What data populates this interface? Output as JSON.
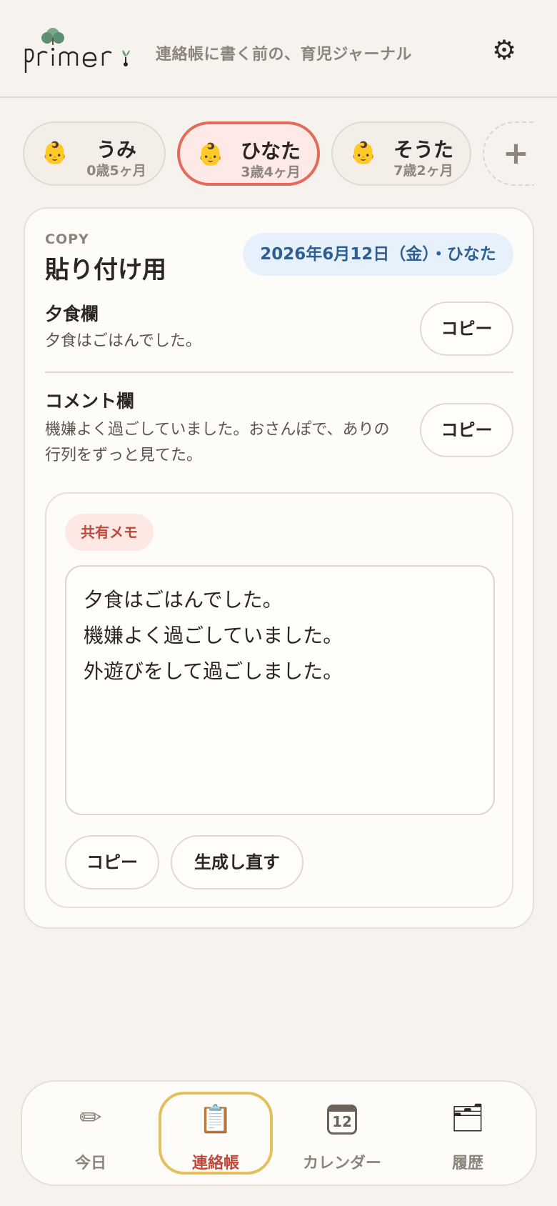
{
  "header": {
    "logo_text": "primer",
    "tagline": "連絡帳に書く前の、育児ジャーナル",
    "settings_icon": "gear-icon"
  },
  "children": [
    {
      "avatar": "👶",
      "name": "うみ",
      "age": "0歳5ヶ月",
      "selected": false
    },
    {
      "avatar": "👶",
      "name": "ひなた",
      "age": "3歳4ヶ月",
      "selected": true
    },
    {
      "avatar": "👶",
      "name": "そうた",
      "age": "7歳2ヶ月",
      "selected": false
    }
  ],
  "add_child": {
    "label": "+",
    "icon": "plus-icon"
  },
  "copy_card": {
    "eyebrow": "COPY",
    "title": "貼り付け用",
    "date_badge": "2026年6月12日（金）・ひなた",
    "fields": [
      {
        "title": "夕食欄",
        "body": "夕食はごはんでした。",
        "button": "コピー"
      },
      {
        "title": "コメント欄",
        "body": "機嫌よく過ごしていました。おさんぽで、ありの行列をずっと見てた。",
        "button": "コピー"
      }
    ],
    "memo": {
      "badge": "共有メモ",
      "lines": [
        "夕食はごはんでした。",
        "機嫌よく過ごしていました。",
        "外遊びをして過ごしました。"
      ],
      "copy_button": "コピー",
      "regenerate_button": "生成し直す"
    }
  },
  "bottom_nav": [
    {
      "icon": "pencil-icon",
      "glyph": "✏",
      "label": "今日",
      "active": false
    },
    {
      "icon": "clipboard-icon",
      "glyph": "📋",
      "label": "連絡帳",
      "active": true
    },
    {
      "icon": "calendar-icon",
      "glyph": "12",
      "label": "カレンダー",
      "active": false
    },
    {
      "icon": "archive-box-icon",
      "glyph": "🗂",
      "label": "履歴",
      "active": false
    }
  ],
  "colors": {
    "background": "#f6f3ee",
    "accent_red": "#e26b5b",
    "active_nav_border": "#e4c05a",
    "date_badge_bg": "#e7f1fb",
    "date_badge_text": "#2f5f92"
  }
}
